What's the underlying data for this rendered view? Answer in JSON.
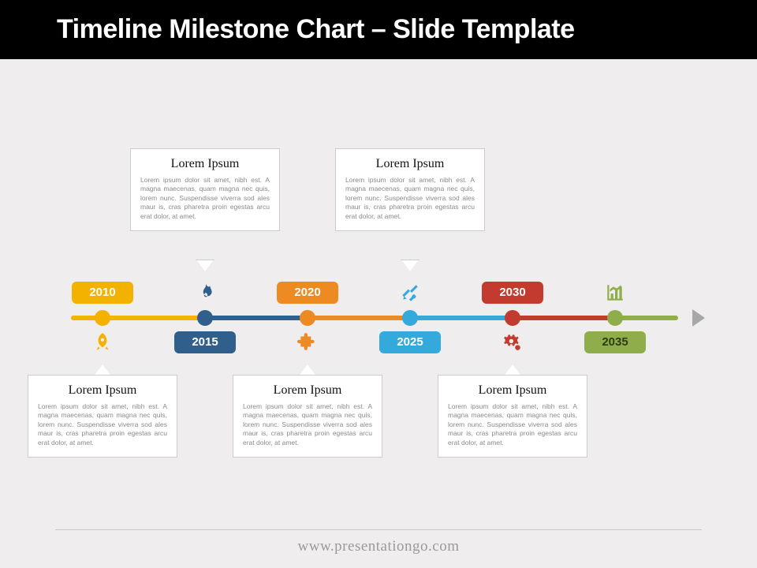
{
  "title": "Timeline Milestone Chart – Slide Template",
  "footer_url": "www.presentationgo.com",
  "colors": {
    "c2010": "#f3b200",
    "c2015": "#2f5f8a",
    "c2020": "#ed8b22",
    "c2025": "#34aadc",
    "c2030": "#c23b2e",
    "c2035": "#8fad4a",
    "arrow": "#a7a7a7"
  },
  "milestones": [
    {
      "year": "2010",
      "icon": "rocket-icon",
      "side": "bottom",
      "heading": "Lorem Ipsum",
      "body": "Lorem ipsum dolor sit amet, nibh est. A magna maecenas, quam magna nec quis, lorem nunc. Suspendisse viverra sod ales maur is, cras pharetra proin egestas arcu erat dolor, at amet."
    },
    {
      "year": "2015",
      "icon": "flame-icon",
      "side": "top",
      "heading": "Lorem Ipsum",
      "body": "Lorem ipsum dolor sit amet, nibh est. A magna maecenas, quam magna nec quis, lorem nunc. Suspendisse viverra sod ales maur is, cras pharetra proin egestas arcu erat dolor, at amet."
    },
    {
      "year": "2020",
      "icon": "puzzle-icon",
      "side": "bottom",
      "heading": "Lorem Ipsum",
      "body": "Lorem ipsum dolor sit amet, nibh est. A magna maecenas, quam magna nec quis, lorem nunc. Suspendisse viverra sod ales maur is, cras pharetra proin egestas arcu erat dolor, at amet."
    },
    {
      "year": "2025",
      "icon": "tools-icon",
      "side": "top",
      "heading": "Lorem Ipsum",
      "body": "Lorem ipsum dolor sit amet, nibh est. A magna maecenas, quam magna nec quis, lorem nunc. Suspendisse viverra sod ales maur is, cras pharetra proin egestas arcu erat dolor, at amet."
    },
    {
      "year": "2030",
      "icon": "gears-icon",
      "side": "bottom",
      "heading": "Lorem Ipsum",
      "body": "Lorem ipsum dolor sit amet, nibh est. A magna maecenas, quam magna nec quis, lorem nunc. Suspendisse viverra sod ales maur is, cras pharetra proin egestas arcu erat dolor, at amet."
    },
    {
      "year": "2035",
      "icon": "chart-icon",
      "side": "none",
      "heading": "",
      "body": ""
    }
  ],
  "chart_data": {
    "type": "timeline",
    "title": "Timeline Milestone Chart – Slide Template",
    "x": [
      2010,
      2015,
      2020,
      2025,
      2030,
      2035
    ],
    "ticks": [
      "2010",
      "2015",
      "2020",
      "2025",
      "2030",
      "2035"
    ],
    "segments": [
      {
        "from": 2010,
        "to": 2015,
        "color": "#f3b200"
      },
      {
        "from": 2015,
        "to": 2020,
        "color": "#2f5f8a"
      },
      {
        "from": 2020,
        "to": 2025,
        "color": "#ed8b22"
      },
      {
        "from": 2025,
        "to": 2030,
        "color": "#34aadc"
      },
      {
        "from": 2030,
        "to": 2035,
        "color": "#c23b2e"
      },
      {
        "from": 2035,
        "to": 2036,
        "color": "#8fad4a"
      }
    ],
    "annotations": [
      {
        "x": 2010,
        "side": "bottom",
        "title": "Lorem Ipsum"
      },
      {
        "x": 2015,
        "side": "top",
        "title": "Lorem Ipsum"
      },
      {
        "x": 2020,
        "side": "bottom",
        "title": "Lorem Ipsum"
      },
      {
        "x": 2025,
        "side": "top",
        "title": "Lorem Ipsum"
      },
      {
        "x": 2030,
        "side": "bottom",
        "title": "Lorem Ipsum"
      }
    ],
    "xlim": [
      2010,
      2035
    ]
  }
}
